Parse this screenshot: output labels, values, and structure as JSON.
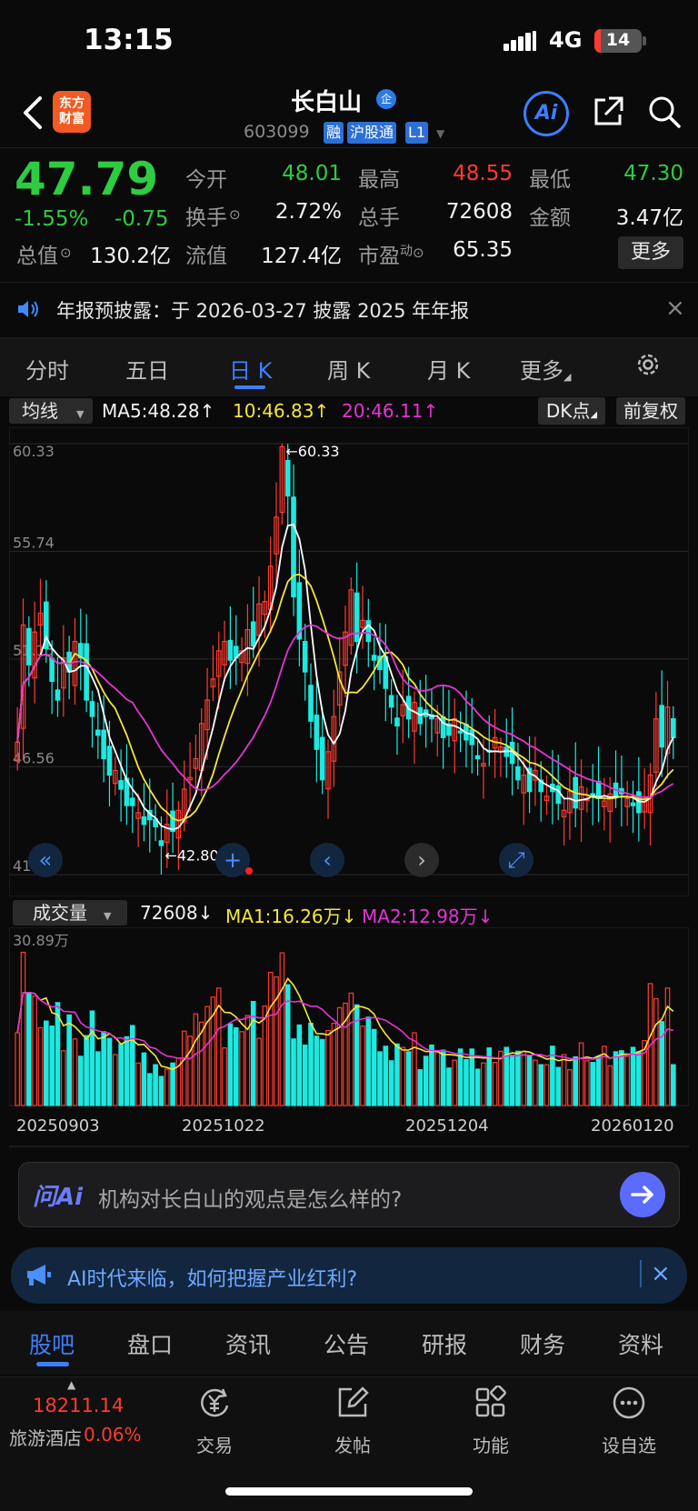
{
  "status_bar": {
    "time": "13:15",
    "network": "4G",
    "battery": "14",
    "battery_level": 0.14
  },
  "header": {
    "logo_line1": "东方",
    "logo_line2": "财富",
    "stock_name": "长白山",
    "qi_badge": "企",
    "stock_code": "603099",
    "tags": [
      "融",
      "沪股通",
      "L1"
    ],
    "ai_label": "Ai"
  },
  "quote": {
    "last": "47.79",
    "change_pct": "-1.55%",
    "change_amt": "-0.75",
    "fields": {
      "open_label": "今开",
      "open": "48.01",
      "high_label": "最高",
      "high": "48.55",
      "low_label": "最低",
      "low": "47.30",
      "turnover_label": "换手",
      "turnover": "2.72%",
      "volume_label": "总手",
      "volume": "72608",
      "amount_label": "金额",
      "amount": "3.47亿",
      "mktcap_label": "总值",
      "mktcap": "130.2亿",
      "float_label": "流值",
      "float": "127.4亿",
      "pe_label": "市盈",
      "pe_sup": "动",
      "pe": "65.35"
    },
    "more_label": "更多"
  },
  "announcement": {
    "text": "年报预披露：于 2026-03-27 披露 2025 年年报",
    "close": "×"
  },
  "chart_tabs": [
    "分时",
    "五日",
    "日 K",
    "周 K",
    "月 K",
    "更多"
  ],
  "ma": {
    "select_label": "均线",
    "ma5": "MA5:48.28↑",
    "ma10": "10:46.83↑",
    "ma20": "20:46.11↑",
    "dk_label": "DK点",
    "fq_label": "前复权"
  },
  "volume": {
    "select_label": "成交量",
    "value": "72608↓",
    "ma1": "MA1:16.26万↓",
    "ma2": "MA2:12.98万↓"
  },
  "chart_data": {
    "type": "candlestick",
    "y_ticks": [
      "60.33",
      "55.74",
      "51.15",
      "46.56",
      "41.96"
    ],
    "ylim": [
      41.96,
      60.33
    ],
    "max_label": "←60.33",
    "min_label": "←42.80",
    "vol_max_label": "30.89万",
    "dates": [
      "20250903",
      "20251022",
      "20251204",
      "20260120"
    ],
    "colors": {
      "up": "#ff3b30",
      "down": "#1de9e0",
      "ma5": "#ffffff",
      "ma10": "#f5e63a",
      "ma20": "#e434d4"
    },
    "close": [
      47.6,
      52.6,
      50.9,
      52.3,
      53.1,
      51.6,
      50.2,
      49.4,
      51.2,
      50.6,
      51.9,
      51.2,
      49.4,
      48.7,
      47.9,
      46.9,
      46.2,
      46.4,
      45.6,
      44.9,
      44.9,
      44.6,
      44.1,
      44.3,
      44.0,
      43.2,
      44.1,
      43.8,
      44.7,
      45.6,
      46.1,
      46.9,
      48.4,
      49.4,
      50.3,
      51.5,
      51.9,
      51.1,
      51.2,
      51.5,
      52.4,
      51.7,
      53.5,
      53.6,
      55.1,
      57.2,
      60.2,
      58.1,
      53.8,
      52.0,
      50.6,
      48.5,
      47.3,
      46.0,
      47.2,
      48.7,
      50.6,
      52.3,
      54.1,
      51.9,
      52.8,
      51.9,
      51.1,
      50.7,
      49.9,
      49.1,
      48.3,
      49.2,
      48.6,
      49.3,
      48.4,
      48.7,
      48.6,
      48.6,
      47.8,
      47.9,
      48.6,
      48.0,
      47.7,
      47.5,
      46.9,
      46.7,
      47.2,
      47.8,
      47.4,
      47.0,
      46.7,
      46.0,
      46.2,
      45.5,
      46.4,
      45.5,
      45.3,
      45.5,
      45.0,
      44.7,
      45.5,
      44.8,
      45.7,
      45.2,
      45.4,
      45.2,
      45.1,
      45.4,
      45.3,
      45.4,
      45.2,
      44.9,
      44.6,
      45.2,
      46.2,
      48.6,
      47.4,
      49.1,
      47.8
    ],
    "volume_wan": [
      13.0,
      27.4,
      20.2,
      19.6,
      13.9,
      15.1,
      14.2,
      18.4,
      9.8,
      16.2,
      11.9,
      8.8,
      12.5,
      16.9,
      9.6,
      13.2,
      12.0,
      9.1,
      11.0,
      12.3,
      14.3,
      7.6,
      9.4,
      5.7,
      7.3,
      5.2,
      6.5,
      7.6,
      8.5,
      13.3,
      12.4,
      16.4,
      14.9,
      17.7,
      19.4,
      21.0,
      10.3,
      14.6,
      13.9,
      13.2,
      16.1,
      18.6,
      12.0,
      17.8,
      23.8,
      23.0,
      27.3,
      21.6,
      11.9,
      14.4,
      10.8,
      14.7,
      12.4,
      11.8,
      13.4,
      14.7,
      17.5,
      18.3,
      20.1,
      18.0,
      14.2,
      15.8,
      13.6,
      9.6,
      10.6,
      8.0,
      11.0,
      10.4,
      9.6,
      13.0,
      6.4,
      8.8,
      10.8,
      9.5,
      9.9,
      6.7,
      8.1,
      10.1,
      8.2,
      10.1,
      6.5,
      7.6,
      10.3,
      7.7,
      9.7,
      10.4,
      9.0,
      9.7,
      9.7,
      9.0,
      8.1,
      7.3,
      7.3,
      10.6,
      6.8,
      9.1,
      6.4,
      8.7,
      11.2,
      8.0,
      7.7,
      8.8,
      10.6,
      7.1,
      9.6,
      9.8,
      8.8,
      10.4,
      9.6,
      11.6,
      21.8,
      19.1,
      15.0,
      21.0,
      7.3
    ]
  },
  "ask": {
    "logo": "问Ai",
    "placeholder": "机构对长白山的观点是怎么样的?"
  },
  "banner": {
    "text": "AI时代来临，如何把握产业红利?",
    "close": "×"
  },
  "bottom_tabs": [
    "股吧",
    "盘口",
    "资讯",
    "公告",
    "研报",
    "财务",
    "资料"
  ],
  "toolbar": {
    "index_value": "18211.14",
    "index_name": "旅游酒店",
    "index_pct": "0.06%",
    "items": [
      "交易",
      "发帖",
      "功能",
      "设自选"
    ]
  }
}
